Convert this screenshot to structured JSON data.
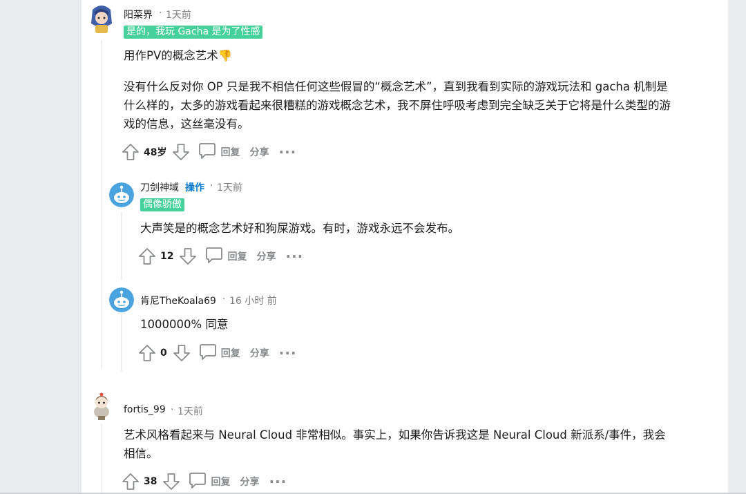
{
  "comments": [
    {
      "author": "阳菜界",
      "time": "1天前",
      "flair": "是的，我玩 Gacha 是为了性感",
      "body": [
        "用作PV的概念艺术👎",
        "没有什么反对你 OP 只是我不相信任何这些假冒的“概念艺术”，直到我看到实际的游戏玩法和 gacha 机制是什么样的，太多的游戏看起来很糟糕的游戏概念艺术，我不屏住呼吸考虑到完全缺乏关于它将是什么类型的游戏的信息，这丝毫没有。"
      ],
      "votes": "48岁",
      "reply": "回复",
      "share": "分享",
      "more": "···"
    },
    {
      "author": "刀剑神域",
      "op": "操作",
      "time": "1天前",
      "flair": "偶像骄傲",
      "body": [
        "大声笑是的概念艺术好和狗屎游戏。有时，游戏永远不会发布。"
      ],
      "votes": "12",
      "reply": "回复",
      "share": "分享",
      "more": "···"
    },
    {
      "author": "肯尼TheKoala69",
      "time": "16 小时 前",
      "body": [
        "1000000% 同意"
      ],
      "votes": "0",
      "reply": "回复",
      "share": "分享",
      "more": "···"
    },
    {
      "author": "fortis_99",
      "time": "1天前",
      "body": [
        "艺术风格看起来与 Neural Cloud 非常相似。事实上，如果你告诉我这是 Neural Cloud 新派系/事件，我会相信。"
      ],
      "votes": "38",
      "reply": "回复",
      "share": "分享",
      "more": "···"
    }
  ],
  "meta_separator": "·",
  "icons": [
    "upvote-icon",
    "downvote-icon",
    "comment-bubble-icon"
  ],
  "colors": {
    "flair_bg": "#46d19b",
    "op_blue": "#0079d3",
    "muted": "#878a8c",
    "avatar_blue": "#4aa3df"
  }
}
